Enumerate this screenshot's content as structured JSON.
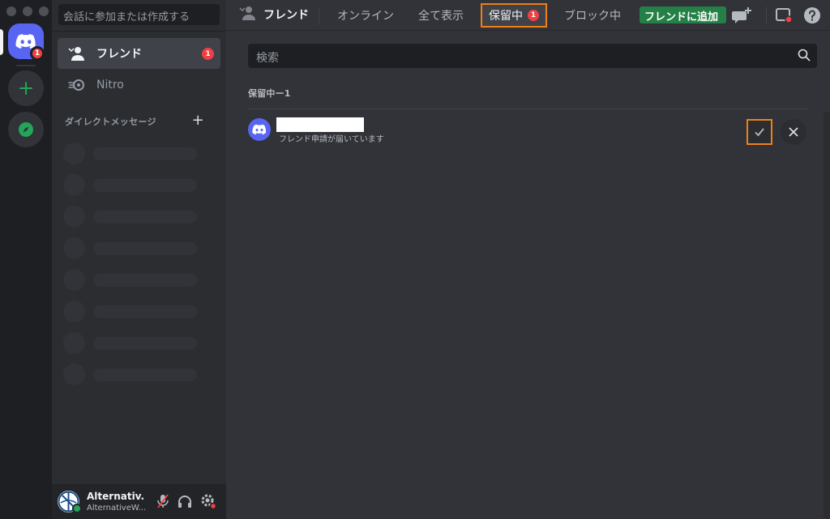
{
  "rail": {
    "home_badge": "1",
    "add_server_label": "+"
  },
  "sidebar": {
    "search_placeholder": "会話に参加または作成する",
    "items": [
      {
        "label": "フレンド",
        "badge": "1",
        "icon": "friends-icon"
      },
      {
        "label": "Nitro",
        "icon": "nitro-icon"
      }
    ],
    "dm_header": "ダイレクトメッセージ",
    "dm_add": "+"
  },
  "user": {
    "name": "Alternativ...",
    "tag": "AlternativeW...",
    "status_color": "#23a55a"
  },
  "topbar": {
    "title": "フレンド",
    "tabs": [
      {
        "label": "オンライン"
      },
      {
        "label": "全て表示"
      },
      {
        "label": "保留中",
        "badge": "1",
        "selected": true
      },
      {
        "label": "ブロック中"
      }
    ],
    "add_friend": "フレンドに追加"
  },
  "main": {
    "search_placeholder": "検索",
    "section_header": "保留中ー1",
    "request": {
      "subtitle": "フレンド申請が届いています"
    }
  },
  "colors": {
    "accent": "#5865f2",
    "highlight": "#f07f19",
    "danger": "#f23f43",
    "success": "#248046"
  }
}
